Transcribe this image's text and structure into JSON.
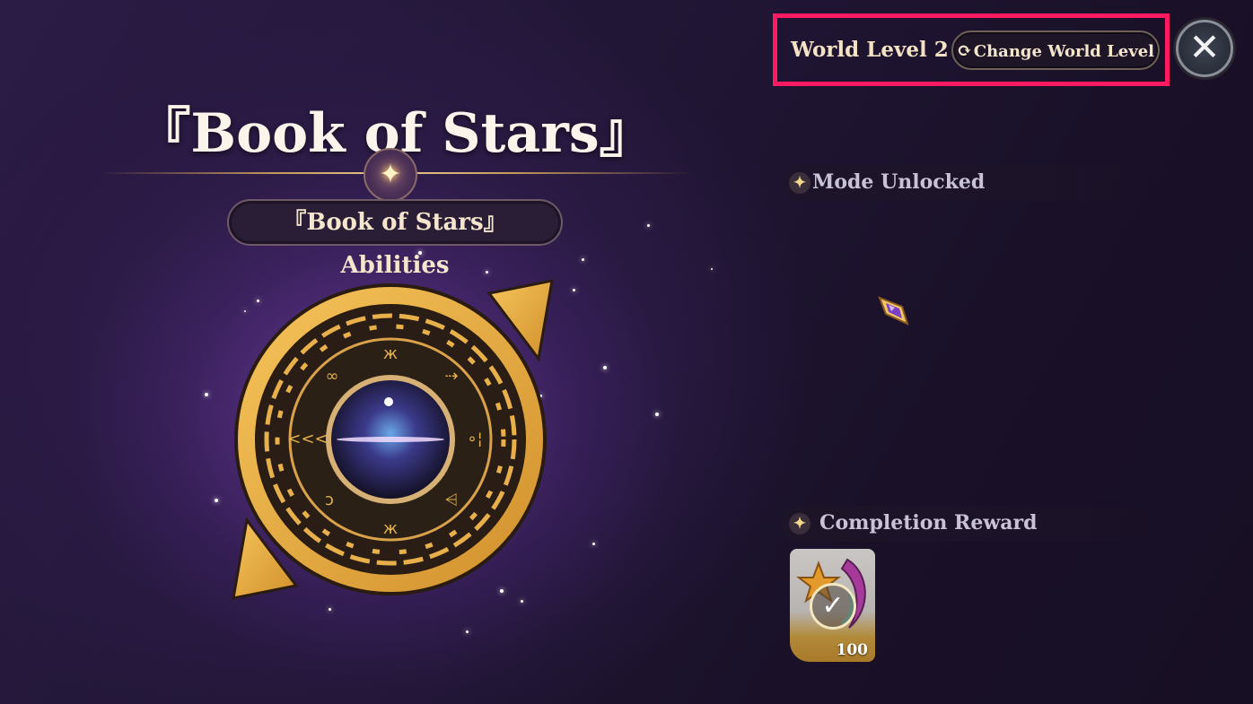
{
  "title": "『Book of Stars』",
  "abilities_label": "『Book of Stars』 Abilities",
  "world": {
    "level_label": "World Level 2",
    "change_button_label": "Change World Level"
  },
  "sections": {
    "mode_unlocked": "Mode Unlocked",
    "completion_reward": "Completion Reward"
  },
  "reward": {
    "quantity": "100",
    "claimed": true
  },
  "icons": {
    "refresh": "refresh-icon",
    "close": "close-icon",
    "sparkle": "sparkle-icon",
    "crystal": "crystal-icon",
    "check": "check-icon"
  },
  "colors": {
    "highlight_border": "#ff1a62",
    "gold": "#e0a53a",
    "background": "#231735"
  }
}
